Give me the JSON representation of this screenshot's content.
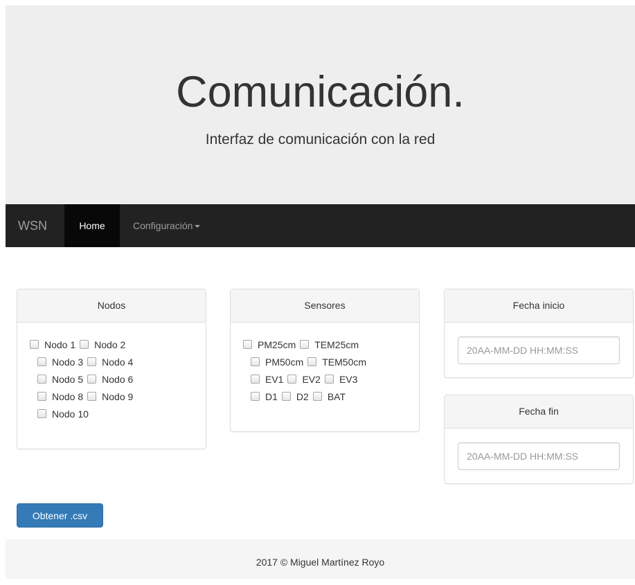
{
  "jumbotron": {
    "title": "Comunicación.",
    "subtitle": "Interfaz de comunicación con la red"
  },
  "navbar": {
    "brand": "WSN",
    "home": "Home",
    "config": "Configuración"
  },
  "nodos": {
    "heading": "Nodos",
    "rows": [
      [
        "Nodo 1",
        "Nodo 2"
      ],
      [
        "Nodo 3",
        "Nodo 4"
      ],
      [
        "Nodo 5",
        "Nodo 6"
      ],
      [
        "Nodo 8",
        "Nodo 9"
      ],
      [
        "Nodo 10"
      ]
    ]
  },
  "sensores": {
    "heading": "Sensores",
    "rows": [
      [
        "PM25cm",
        "TEM25cm"
      ],
      [
        "PM50cm",
        "TEM50cm"
      ],
      [
        "EV1",
        "EV2",
        "EV3"
      ],
      [
        "D1",
        "D2",
        "BAT"
      ]
    ]
  },
  "fecha_inicio": {
    "heading": "Fecha inicio",
    "placeholder": "20AA-MM-DD HH:MM:SS",
    "value": ""
  },
  "fecha_fin": {
    "heading": "Fecha fin",
    "placeholder": "20AA-MM-DD HH:MM:SS",
    "value": ""
  },
  "actions": {
    "submit_label": "Obtener .csv"
  },
  "footer": {
    "text": "2017 © Miguel Martínez Royo"
  },
  "colors": {
    "primary": "#337ab7",
    "navbar_bg": "#222222",
    "jumbotron_bg": "#eeeeee"
  }
}
